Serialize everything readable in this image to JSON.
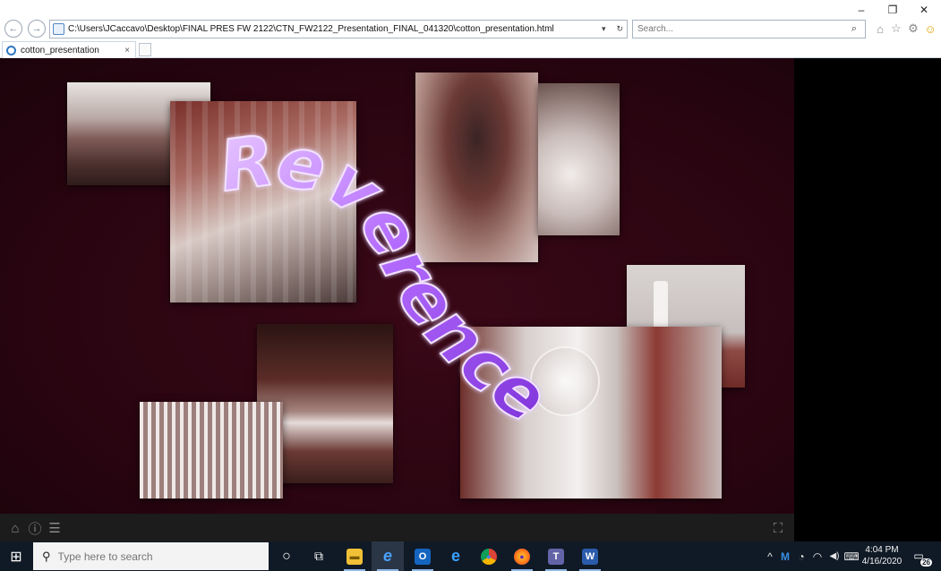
{
  "browser": {
    "address_url": "C:\\Users\\JCaccavo\\Desktop\\FINAL PRES FW 2122\\CTN_FW2122_Presentation_FINAL_041320\\cotton_presentation.html",
    "search_placeholder": "Search...",
    "tab_title": "cotton_presentation",
    "tab_close": "×",
    "back_glyph": "←",
    "forward_glyph": "→",
    "dropdown_glyph": "▾",
    "refresh_glyph": "↻",
    "minimize_glyph": "–",
    "restore_glyph": "❐",
    "close_glyph": "✕",
    "search_glyph": "⌕",
    "home_glyph": "⌂",
    "favorites_glyph": "☆",
    "settings_glyph": "⚙",
    "feedback_glyph": "☺"
  },
  "slide": {
    "headline": "Reverence",
    "headline_color": "#b46cff",
    "background_color": "#2a0511"
  },
  "viewer_bar": {
    "home_glyph": "⌂",
    "info_glyph": "ⓘ",
    "menu_glyph": "☰",
    "fullscreen_glyph": "⛶"
  },
  "taskbar": {
    "start_glyph": "⊞",
    "search_glyph": "⚲",
    "search_placeholder": "Type here to search",
    "cortana_glyph": "○",
    "taskview_glyph": "⧉",
    "apps": [
      {
        "name": "file-explorer",
        "label": "▬",
        "color": "#f2c037"
      },
      {
        "name": "internet-explorer",
        "label": "e",
        "color": "#2f7fd1"
      },
      {
        "name": "outlook",
        "label": "O",
        "color": "#1565c0"
      },
      {
        "name": "edge",
        "label": "e",
        "color": "#1f8fe0"
      },
      {
        "name": "chrome",
        "label": "●",
        "color": "#db4437"
      },
      {
        "name": "firefox",
        "label": "●",
        "color": "#ff7a1a"
      },
      {
        "name": "teams",
        "label": "T",
        "color": "#6264a7"
      },
      {
        "name": "word",
        "label": "W",
        "color": "#2b5cab"
      }
    ],
    "tray_glyphs": {
      "chevron": "^",
      "malwarebytes": "M",
      "network": "◔",
      "wifi": "◠",
      "volume": "◀)",
      "keyboard": "⌨"
    },
    "time": "4:04 PM",
    "date": "4/16/2020",
    "notification_glyph": "▭",
    "notification_count": "26"
  }
}
